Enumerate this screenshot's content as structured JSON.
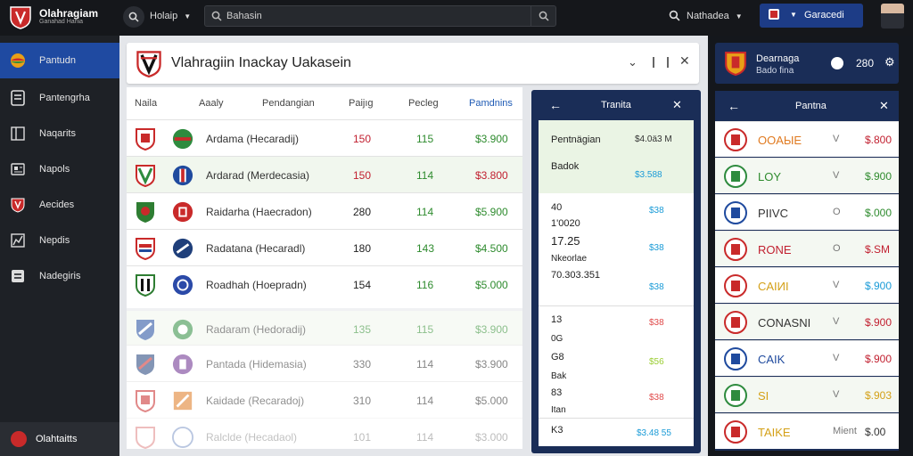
{
  "topbar": {
    "brand_name": "Olahragiam",
    "brand_sub": "Ganahad Hania",
    "filter_label": "Holaip",
    "search_placeholder": "Bahasin",
    "notifications_label": "Nathadea",
    "cta_label": "Garacedi"
  },
  "sidebar": {
    "items": [
      {
        "label": "Pantudn",
        "icon": "ball-icon"
      },
      {
        "label": "Pantengrha",
        "icon": "list-icon"
      },
      {
        "label": "Naqarits",
        "icon": "book-icon"
      },
      {
        "label": "Napols",
        "icon": "news-icon"
      },
      {
        "label": "Aecides",
        "icon": "shield-icon"
      },
      {
        "label": "Nepdis",
        "icon": "chart-icon"
      },
      {
        "label": "Nadegiris",
        "icon": "doc-icon"
      }
    ],
    "footer_label": "Olahtaitts"
  },
  "main": {
    "title": "Vlahragiin Inackay Uakasein",
    "columns": [
      "Naila",
      "Aaaly",
      "Pendangian",
      "Paijıg",
      "Pecleg",
      "Pamdnins"
    ],
    "rows": [
      {
        "name": "Ardama (Hecaradij)",
        "n1": "150",
        "n2": "115",
        "price": "$3.900",
        "c1": "#c92a2a",
        "c2": "#2e8b3e"
      },
      {
        "name": "Ardarad (Merdecasia)",
        "n1": "150",
        "n2": "114",
        "price": "$3.800",
        "c1": "#c92a2a",
        "c2": "#1f4a9e"
      },
      {
        "name": "Raidarha (Haecradon)",
        "n1": "280",
        "n2": "114",
        "price": "$5.900",
        "c1": "#2e7d32",
        "c2": "#c92a2a"
      },
      {
        "name": "Radatana (Hecaradl)",
        "n1": "180",
        "n2": "143",
        "price": "$4.500",
        "c1": "#c92a2a",
        "c2": "#1f3f7a"
      },
      {
        "name": "Roadhah (Hoepradn)",
        "n1": "154",
        "n2": "116",
        "price": "$5.000",
        "c1": "#2e7d32",
        "c2": "#2b4aa8"
      },
      {
        "name": "Radaram (Hedoradij)",
        "n1": "135",
        "n2": "115",
        "price": "$3.900",
        "c1": "#1f4a9e",
        "c2": "#2e8b3e"
      },
      {
        "name": "Pantada (Hidemasia)",
        "n1": "330",
        "n2": "114",
        "price": "$3.900",
        "c1": "#1f3f7a",
        "c2": "#6a2c8e"
      },
      {
        "name": "Kaidade (Recaradoj)",
        "n1": "310",
        "n2": "114",
        "price": "$5.000",
        "c1": "#c92a2a",
        "c2": "#e07a20"
      },
      {
        "name": "Ralclde (Hecadaol)",
        "n1": "101",
        "n2": "114",
        "price": "$3.000",
        "c1": "#c92a2a",
        "c2": "#1f4a9e"
      }
    ]
  },
  "detail": {
    "title": "Tranita",
    "items": [
      {
        "label": "Pentnägian",
        "value": "$4.0ä3 M",
        "color": "#333"
      },
      {
        "label": "Badok",
        "value": "$3.588",
        "color": "#1a9bd7"
      },
      {
        "label": "40",
        "value": "$38",
        "color": "#1a9bd7"
      },
      {
        "label": "1'0020",
        "value": "",
        "color": "#333"
      },
      {
        "label": "17.25",
        "value": "$38",
        "color": "#1a9bd7"
      },
      {
        "label": "Nkeorlae",
        "value": "",
        "color": "#333"
      },
      {
        "label": "70.303.351",
        "value": "$38",
        "color": "#1a9bd7"
      },
      {
        "label": "13",
        "value": "$38",
        "color": "#e04a4a"
      },
      {
        "label": "0G",
        "value": "",
        "color": "#333"
      },
      {
        "label": "G8",
        "value": "$56",
        "color": "#9acd32"
      },
      {
        "label": "Bak",
        "value": "",
        "color": "#333"
      },
      {
        "label": "83",
        "value": "$38",
        "color": "#e04a4a"
      },
      {
        "label": "Itan",
        "value": "",
        "color": "#333"
      },
      {
        "label": "K3",
        "value": "$3.48 55",
        "color": "#1a9bd7"
      }
    ]
  },
  "right": {
    "top_title": "Dearnaga",
    "top_sub": "Bado fina",
    "balance": "280",
    "panel_title": "Pantna",
    "rows": [
      {
        "label": "OOAЫE",
        "change": "V",
        "price": "$.800",
        "lc": "#e07a20",
        "pc": "#c11f2f",
        "crest": "#c92a2a"
      },
      {
        "label": "LOY",
        "change": "V",
        "price": "$.900",
        "lc": "#2e8b2e",
        "pc": "#2e8b2e",
        "crest": "#2e8b3e"
      },
      {
        "label": "PIIVC",
        "change": "O",
        "price": "$.000",
        "lc": "#333",
        "pc": "#2e8b2e",
        "crest": "#1f4a9e"
      },
      {
        "label": "RONE",
        "change": "O",
        "price": "$.SM",
        "lc": "#c11f2f",
        "pc": "#c11f2f",
        "crest": "#c92a2a"
      },
      {
        "label": "CAIИI",
        "change": "V",
        "price": "$.900",
        "lc": "#d4a017",
        "pc": "#1a9bd7",
        "crest": "#c92a2a"
      },
      {
        "label": "CONASNI",
        "change": "V",
        "price": "$.900",
        "lc": "#333",
        "pc": "#c11f2f",
        "crest": "#c92a2a"
      },
      {
        "label": "CAIK",
        "change": "V",
        "price": "$.900",
        "lc": "#1f4a9e",
        "pc": "#c11f2f",
        "crest": "#1f4a9e"
      },
      {
        "label": "SI",
        "change": "V",
        "price": "$.903",
        "lc": "#d4a017",
        "pc": "#d4a017",
        "crest": "#2e8b3e"
      },
      {
        "label": "TAIKE",
        "change": "Mient",
        "price": "$.00",
        "lc": "#d4a017",
        "pc": "#333",
        "crest": "#c92a2a"
      }
    ]
  }
}
